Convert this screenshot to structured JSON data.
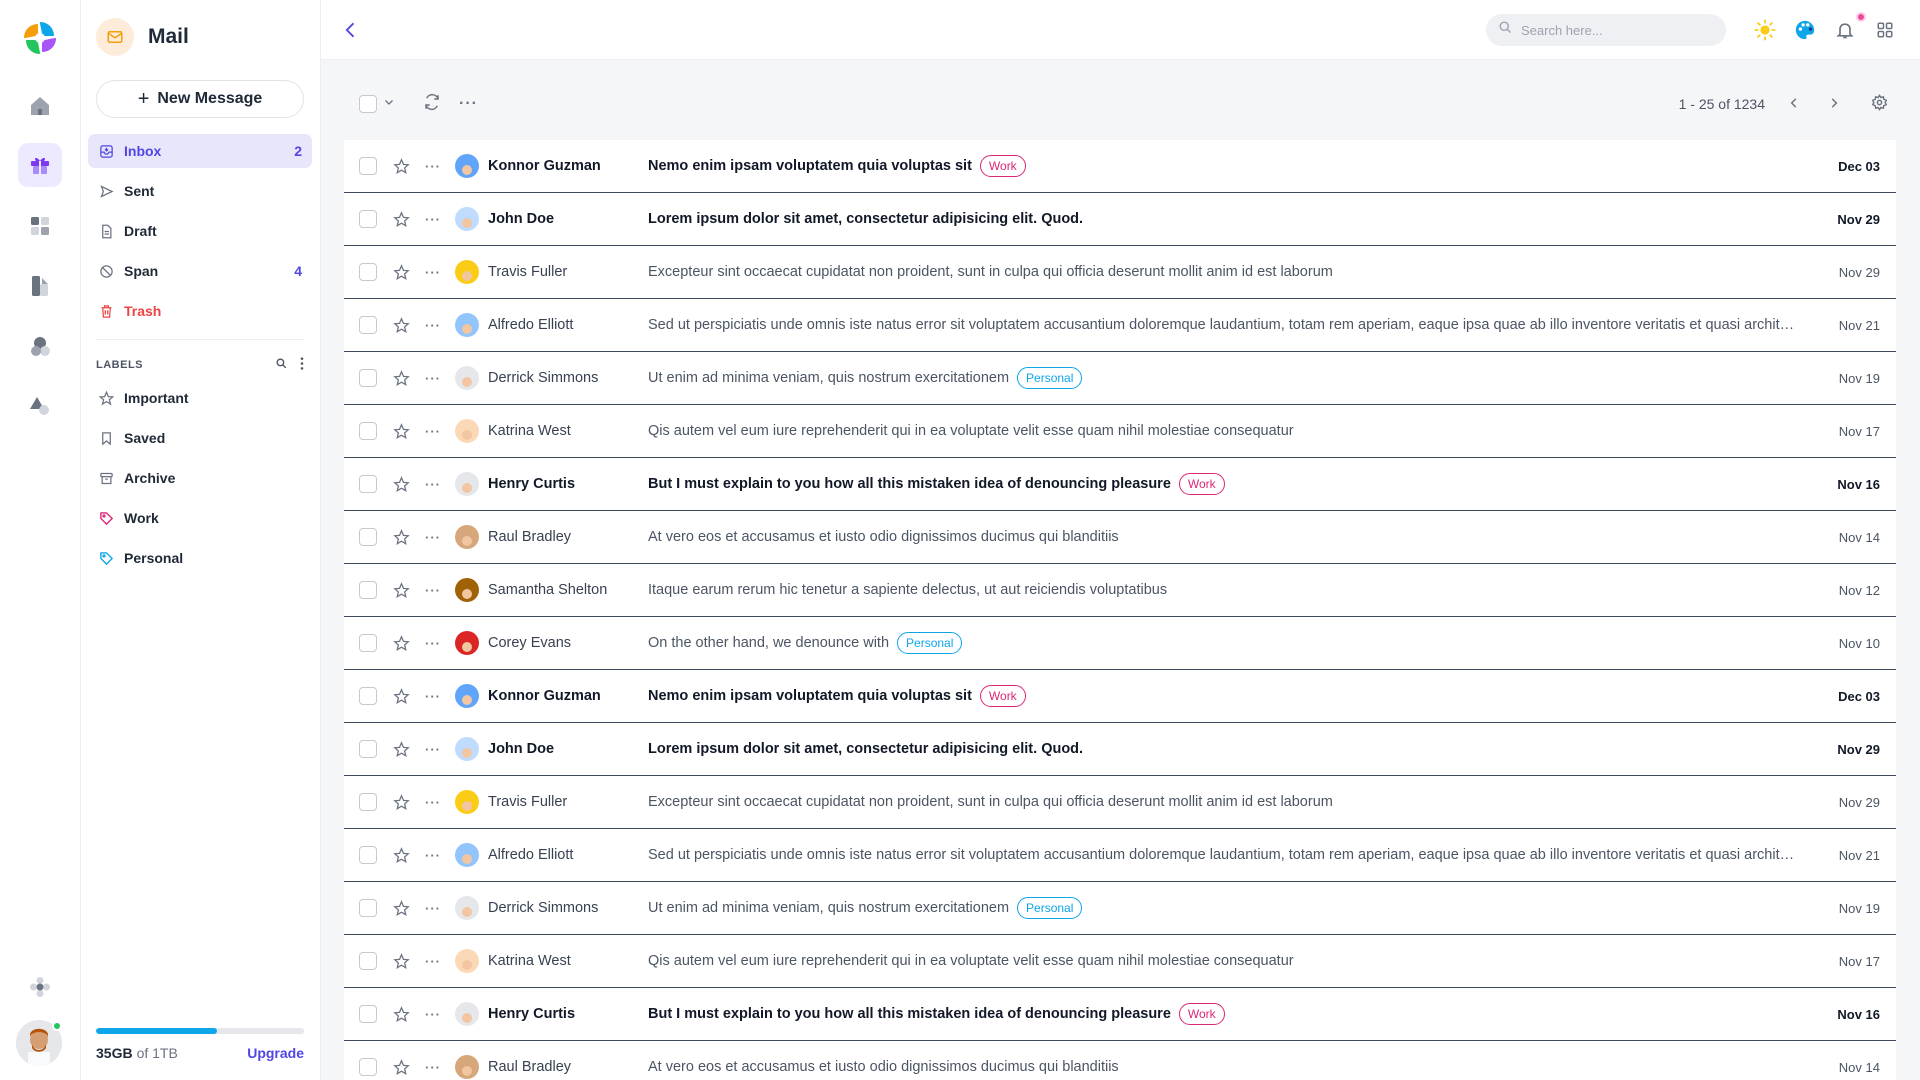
{
  "app": {
    "title": "Mail"
  },
  "sidebar": {
    "new_message_label": "New Message",
    "items": [
      {
        "label": "Inbox",
        "count": "2",
        "icon": "inbox-icon",
        "active": true
      },
      {
        "label": "Sent",
        "count": "",
        "icon": "send-icon"
      },
      {
        "label": "Draft",
        "count": "",
        "icon": "draft-icon"
      },
      {
        "label": "Span",
        "count": "4",
        "icon": "spam-icon"
      },
      {
        "label": "Trash",
        "count": "",
        "icon": "trash-icon"
      }
    ],
    "labels_title": "LABELS",
    "labels": [
      {
        "label": "Important",
        "icon": "star-icon",
        "color": "#6b7280"
      },
      {
        "label": "Saved",
        "icon": "bookmark-icon",
        "color": "#6b7280"
      },
      {
        "label": "Archive",
        "icon": "archive-icon",
        "color": "#6b7280"
      },
      {
        "label": "Work",
        "icon": "tag-icon",
        "color": "#db2777"
      },
      {
        "label": "Personal",
        "icon": "tag-icon",
        "color": "#0ea5e9"
      }
    ],
    "storage": {
      "used": "35GB",
      "total": "of 1TB",
      "upgrade_label": "Upgrade",
      "fraction": 0.58
    }
  },
  "header": {
    "search_placeholder": "Search here..."
  },
  "toolbar": {
    "pagination": "1 - 25 of 1234"
  },
  "colors": {
    "accent": "#4f46e5",
    "work": "#db2777",
    "personal": "#0ea5e9",
    "trash": "#ef4444"
  },
  "emails": [
    {
      "sender": "Konnor Guzman",
      "subject": "Nemo enim ipsam voluptatem quia voluptas sit",
      "tag": "Work",
      "date": "Dec 03",
      "unread": true,
      "avatar": "#60a5fa"
    },
    {
      "sender": "John Doe",
      "subject": "Lorem ipsum dolor sit amet, consectetur adipisicing elit. Quod.",
      "tag": "",
      "date": "Nov 29",
      "unread": true,
      "avatar": "#bfdbfe"
    },
    {
      "sender": "Travis Fuller",
      "subject": "Excepteur sint occaecat cupidatat non proident, sunt in culpa qui officia deserunt mollit anim id est laborum",
      "tag": "",
      "date": "Nov 29",
      "unread": false,
      "avatar": "#facc15"
    },
    {
      "sender": "Alfredo Elliott",
      "subject": "Sed ut perspiciatis unde omnis iste natus error sit voluptatem accusantium doloremque laudantium, totam rem aperiam, eaque ipsa quae ab illo inventore veritatis et quasi architecto beatae vitae dicta sunt explicabo",
      "tag": "",
      "date": "Nov 21",
      "unread": false,
      "avatar": "#93c5fd"
    },
    {
      "sender": "Derrick Simmons",
      "subject": "Ut enim ad minima veniam, quis nostrum exercitationem",
      "tag": "Personal",
      "date": "Nov 19",
      "unread": false,
      "avatar": "#e5e7eb"
    },
    {
      "sender": "Katrina West",
      "subject": "Qis autem vel eum iure reprehenderit qui in ea voluptate velit esse quam nihil molestiae consequatur",
      "tag": "",
      "date": "Nov 17",
      "unread": false,
      "avatar": "#fcd9b6"
    },
    {
      "sender": "Henry Curtis",
      "subject": "But I must explain to you how all this mistaken idea of denouncing pleasure",
      "tag": "Work",
      "date": "Nov 16",
      "unread": true,
      "avatar": "#e5e7eb"
    },
    {
      "sender": "Raul Bradley",
      "subject": "At vero eos et accusamus et iusto odio dignissimos ducimus qui blanditiis",
      "tag": "",
      "date": "Nov 14",
      "unread": false,
      "avatar": "#d6a77a"
    },
    {
      "sender": "Samantha Shelton",
      "subject": "Itaque earum rerum hic tenetur a sapiente delectus, ut aut reiciendis voluptatibus",
      "tag": "",
      "date": "Nov 12",
      "unread": false,
      "avatar": "#a16207"
    },
    {
      "sender": "Corey Evans",
      "subject": "On the other hand, we denounce with",
      "tag": "Personal",
      "date": "Nov 10",
      "unread": false,
      "avatar": "#dc2626"
    },
    {
      "sender": "Konnor Guzman",
      "subject": "Nemo enim ipsam voluptatem quia voluptas sit",
      "tag": "Work",
      "date": "Dec 03",
      "unread": true,
      "avatar": "#60a5fa"
    },
    {
      "sender": "John Doe",
      "subject": "Lorem ipsum dolor sit amet, consectetur adipisicing elit. Quod.",
      "tag": "",
      "date": "Nov 29",
      "unread": true,
      "avatar": "#bfdbfe"
    },
    {
      "sender": "Travis Fuller",
      "subject": "Excepteur sint occaecat cupidatat non proident, sunt in culpa qui officia deserunt mollit anim id est laborum",
      "tag": "",
      "date": "Nov 29",
      "unread": false,
      "avatar": "#facc15"
    },
    {
      "sender": "Alfredo Elliott",
      "subject": "Sed ut perspiciatis unde omnis iste natus error sit voluptatem accusantium doloremque laudantium, totam rem aperiam, eaque ipsa quae ab illo inventore veritatis et quasi architecto beatae vitae dicta sunt explicabo",
      "tag": "",
      "date": "Nov 21",
      "unread": false,
      "avatar": "#93c5fd"
    },
    {
      "sender": "Derrick Simmons",
      "subject": "Ut enim ad minima veniam, quis nostrum exercitationem",
      "tag": "Personal",
      "date": "Nov 19",
      "unread": false,
      "avatar": "#e5e7eb"
    },
    {
      "sender": "Katrina West",
      "subject": "Qis autem vel eum iure reprehenderit qui in ea voluptate velit esse quam nihil molestiae consequatur",
      "tag": "",
      "date": "Nov 17",
      "unread": false,
      "avatar": "#fcd9b6"
    },
    {
      "sender": "Henry Curtis",
      "subject": "But I must explain to you how all this mistaken idea of denouncing pleasure",
      "tag": "Work",
      "date": "Nov 16",
      "unread": true,
      "avatar": "#e5e7eb"
    },
    {
      "sender": "Raul Bradley",
      "subject": "At vero eos et accusamus et iusto odio dignissimos ducimus qui blanditiis",
      "tag": "",
      "date": "Nov 14",
      "unread": false,
      "avatar": "#d6a77a"
    }
  ]
}
